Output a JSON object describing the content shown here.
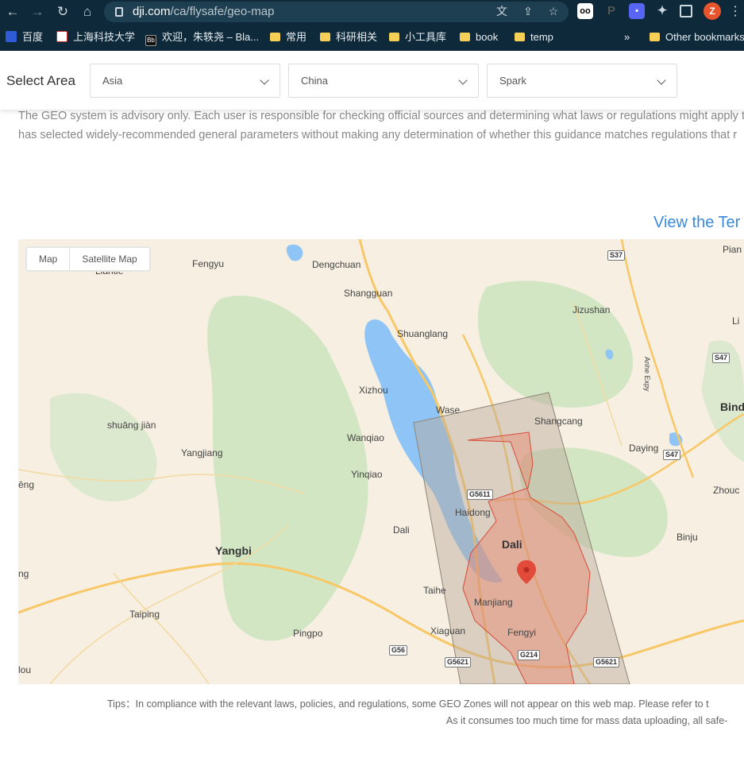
{
  "browser": {
    "url_host": "dji.com",
    "url_path": "/ca/flysafe/geo-map",
    "profile_initial": "Z",
    "bookmarks": [
      "百度",
      "上海科技大学",
      "欢迎，朱轶尧 – Bla...",
      "常用",
      "科研相关",
      "小工具库",
      "book",
      "temp"
    ],
    "bookmarks_more": "»",
    "other_bookmarks": "Other bookmarks"
  },
  "select_area": {
    "label": "Select Area",
    "continent": "Asia",
    "country": "China",
    "drone": "Spark"
  },
  "advisory": {
    "line1": "The GEO system is advisory only. Each user is responsible for checking official sources and determining what laws or regulations might apply to",
    "line2": "has selected widely-recommended general parameters without making any determination of whether this guidance matches regulations that r"
  },
  "view_terms_link": "View the Ter",
  "map": {
    "type_buttons": [
      "Map",
      "Satellite Map"
    ],
    "places": [
      "Liantie",
      "Fengyu",
      "Dengchuan",
      "Shangguan",
      "Shuanglang",
      "Jizushan",
      "Xizhou",
      "Wase",
      "Shangcang",
      "Daying",
      "shuāng jiàn",
      "Wanqiao",
      "Yangjiang",
      "Yinqiao",
      "Haidong",
      "Dali",
      "Dali",
      "Yangbi",
      "Taihe",
      "Manjiang",
      "Fengyi",
      "Taiping",
      "Pingpo",
      "Xiaguan",
      "Binju",
      "Zhouc",
      "Bind",
      "Pian",
      "Li",
      "ēng",
      "ng",
      "lou"
    ],
    "highways": [
      "S37",
      "S47",
      "S47",
      "G5611",
      "G56",
      "G5621",
      "G214",
      "G5621"
    ],
    "vertical_road_label": "Anhe Expy",
    "colors": {
      "water": "#8ec5f6",
      "land": "#f6efe2",
      "forest": "#d3e6c3",
      "road": "#f8c766",
      "restricted": "#e9846d",
      "warning": "#b8a999"
    }
  },
  "tips": {
    "line1": "Tips：In compliance with the relevant laws, policies, and regulations, some GEO Zones will not appear on this web map. Please refer to t",
    "line2": "As it consumes too much time for mass data uploading, all safe-"
  }
}
